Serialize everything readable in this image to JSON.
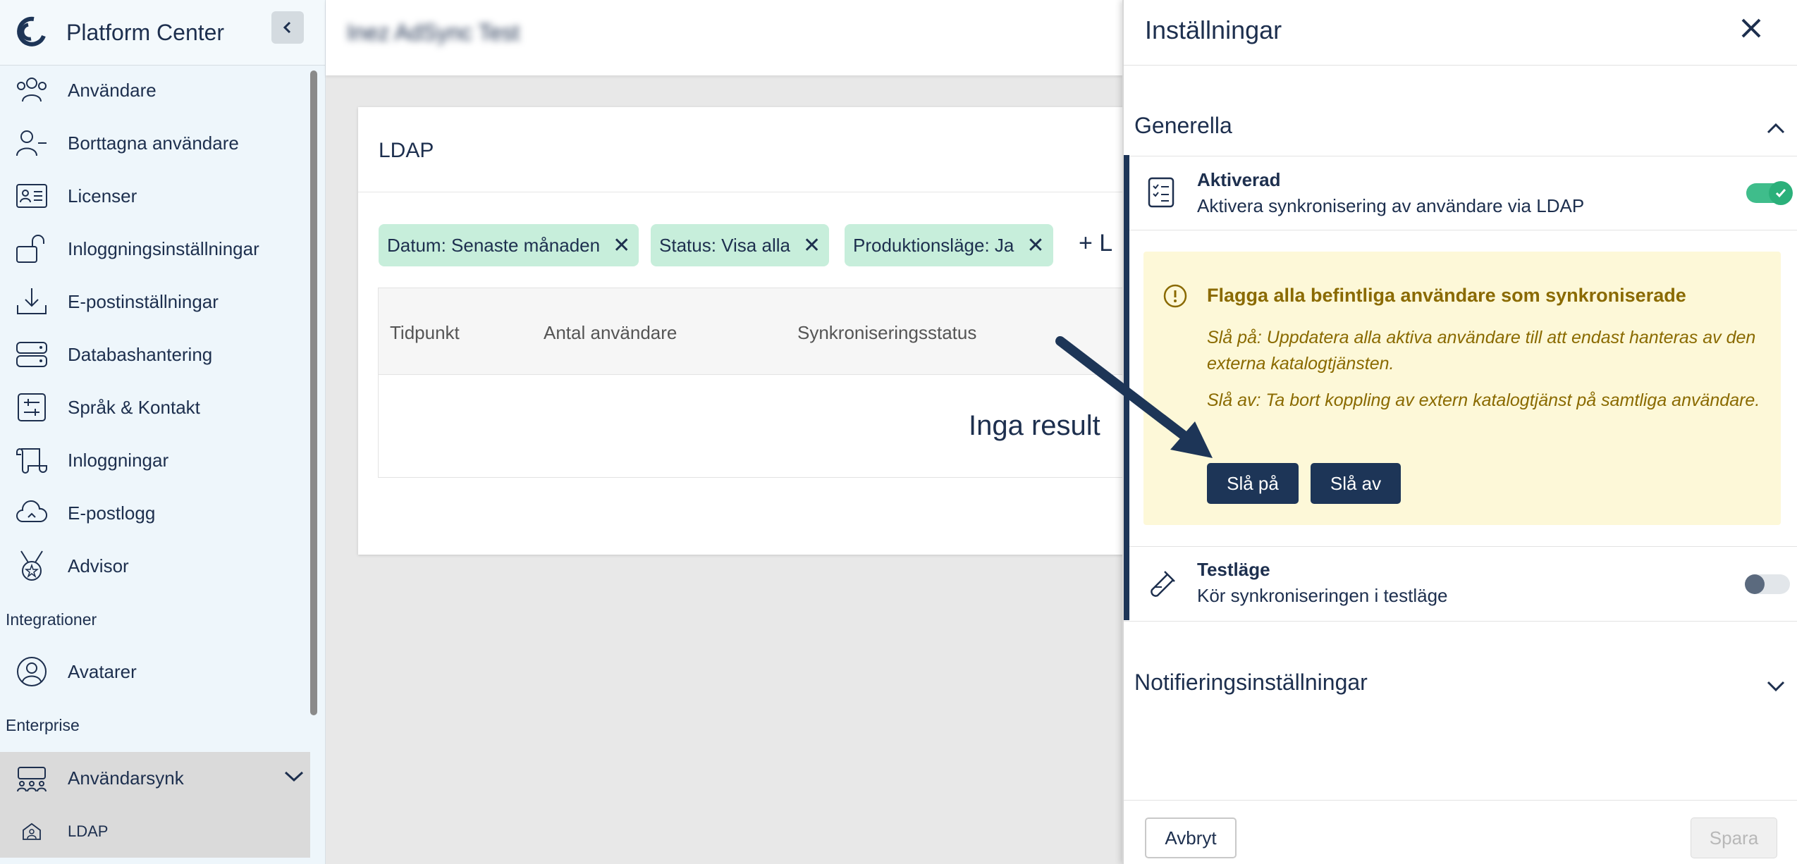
{
  "app": {
    "title": "Platform Center",
    "topbar_title": "Inez AdSync Test"
  },
  "sidebar": {
    "items": [
      {
        "label": "Användare",
        "icon": "users-icon"
      },
      {
        "label": "Borttagna användare",
        "icon": "user-minus-icon"
      },
      {
        "label": "Licenser",
        "icon": "id-card-icon"
      },
      {
        "label": "Inloggningsinställningar",
        "icon": "lock-open-icon"
      },
      {
        "label": "E-postinställningar",
        "icon": "download-icon"
      },
      {
        "label": "Databashantering",
        "icon": "server-icon"
      },
      {
        "label": "Språk & Kontakt",
        "icon": "sliders-icon"
      },
      {
        "label": "Inloggningar",
        "icon": "scroll-icon"
      },
      {
        "label": "E-postlogg",
        "icon": "cloud-icon"
      },
      {
        "label": "Advisor",
        "icon": "medal-icon"
      }
    ],
    "section_integrations": "Integrationer",
    "integrations": [
      {
        "label": "Avatarer",
        "icon": "user-circle-icon"
      }
    ],
    "section_enterprise": "Enterprise",
    "enterprise": [
      {
        "label": "Användarsynk",
        "icon": "people-group-icon"
      }
    ],
    "sub_items": [
      {
        "label": "LDAP",
        "icon": "house-user-icon"
      }
    ]
  },
  "main": {
    "card_title": "LDAP",
    "chips": [
      {
        "label": "Datum: Senaste månaden"
      },
      {
        "label": "Status: Visa alla"
      },
      {
        "label": "Produktionsläge: Ja"
      }
    ],
    "add_filter_label": "+ L",
    "columns": [
      "Tidpunkt",
      "Antal användare",
      "Synkroniseringsstatus"
    ],
    "empty_text": "Inga result"
  },
  "panel": {
    "title": "Inställningar",
    "general_title": "Generella",
    "activated": {
      "title": "Aktiverad",
      "subtitle": "Aktivera synkronisering av användare via LDAP",
      "on": true
    },
    "alert": {
      "title": "Flagga alla befintliga användare som synkroniserade",
      "text_on": "Slå på: Uppdatera alla aktiva användare till att endast hanteras av den externa katalogtjänsten.",
      "text_off": "Slå av: Ta bort koppling av extern katalogtjänst på samtliga användare.",
      "btn_on": "Slå på",
      "btn_off": "Slå av"
    },
    "testmode": {
      "title": "Testläge",
      "subtitle": "Kör synkroniseringen i testläge",
      "on": false
    },
    "notif_title": "Notifieringsinställningar",
    "cancel_label": "Avbryt",
    "save_label": "Spara"
  },
  "colors": {
    "accent": "#1d3557",
    "chip": "#c7eedb",
    "toggle_on": "#3fbd8b",
    "alert_bg": "#fdf8d8"
  }
}
